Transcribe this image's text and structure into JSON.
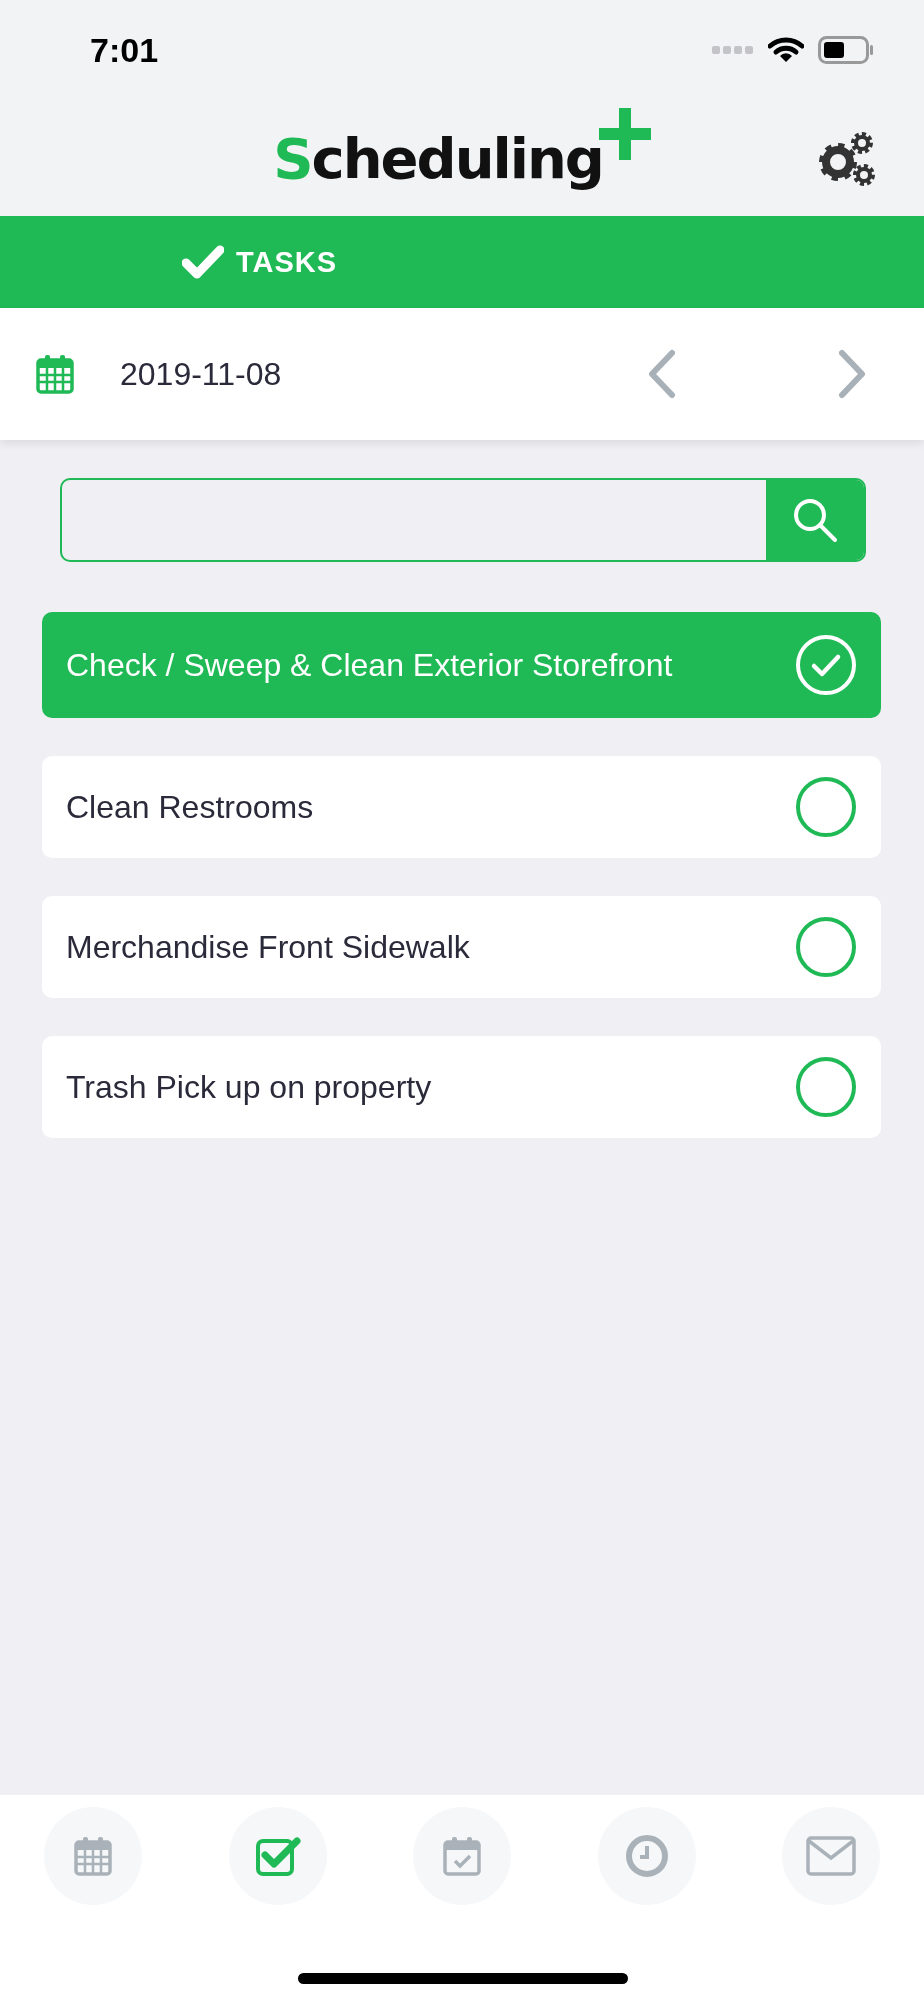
{
  "status_bar": {
    "time": "7:01"
  },
  "header": {
    "logo": "Scheduling"
  },
  "tab": {
    "label": "TASKS"
  },
  "date_bar": {
    "date": "2019-11-08"
  },
  "tasks": [
    {
      "title": "Check / Sweep & Clean Exterior Storefront",
      "checked": true
    },
    {
      "title": "Clean Restrooms",
      "checked": false
    },
    {
      "title": "Merchandise Front Sidewalk",
      "checked": false
    },
    {
      "title": "Trash Pick up on property",
      "checked": false
    }
  ],
  "bottom_nav": [
    {
      "kind": "calendar",
      "selected": false
    },
    {
      "kind": "tasks",
      "selected": true
    },
    {
      "kind": "schedule",
      "selected": false
    },
    {
      "kind": "clock",
      "selected": false
    },
    {
      "kind": "mail",
      "selected": false
    }
  ]
}
